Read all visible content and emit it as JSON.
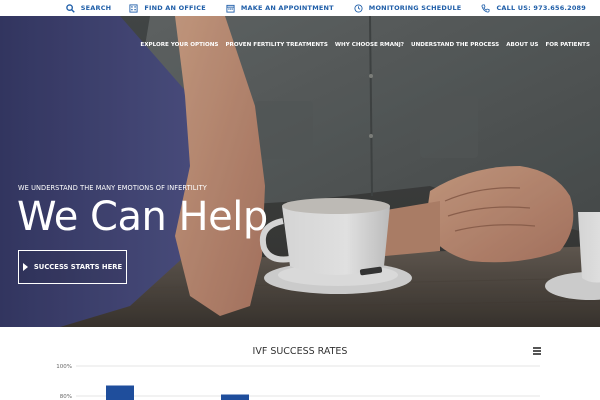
{
  "utility_bar": {
    "search": "SEARCH",
    "find_office": "FIND AN OFFICE",
    "appointment": "MAKE AN APPOINTMENT",
    "monitoring": "MONITORING SCHEDULE",
    "call": "CALL US: 973.656.2089"
  },
  "nav": {
    "items": [
      {
        "label": "EXPLORE YOUR OPTIONS"
      },
      {
        "label": "PROVEN FERTILITY TREATMENTS"
      },
      {
        "label": "WHY CHOOSE RMANJ?"
      },
      {
        "label": "UNDERSTAND THE PROCESS"
      },
      {
        "label": "ABOUT US"
      },
      {
        "label": "FOR PATIENTS"
      }
    ]
  },
  "hero": {
    "eyebrow": "WE UNDERSTAND THE MANY EMOTIONS OF INFERTILITY",
    "title": "We Can Help",
    "cta": "SUCCESS STARTS HERE"
  },
  "colors": {
    "brand_blue": "#1f5ea8",
    "bar_blue": "#1f4e9c"
  },
  "icons": {
    "search": "search-icon",
    "office": "building-icon",
    "appointment": "calendar-icon",
    "monitoring": "clock-icon",
    "phone": "phone-icon",
    "menu": "hamburger-icon"
  },
  "chart_data": {
    "type": "bar",
    "title": "IVF SUCCESS RATES",
    "xlabel": "",
    "ylabel": "",
    "ylim": [
      0,
      100
    ],
    "yticks": [
      "100%",
      "80%"
    ],
    "grid": true,
    "series": [
      {
        "values": [
          87,
          81
        ]
      }
    ]
  }
}
